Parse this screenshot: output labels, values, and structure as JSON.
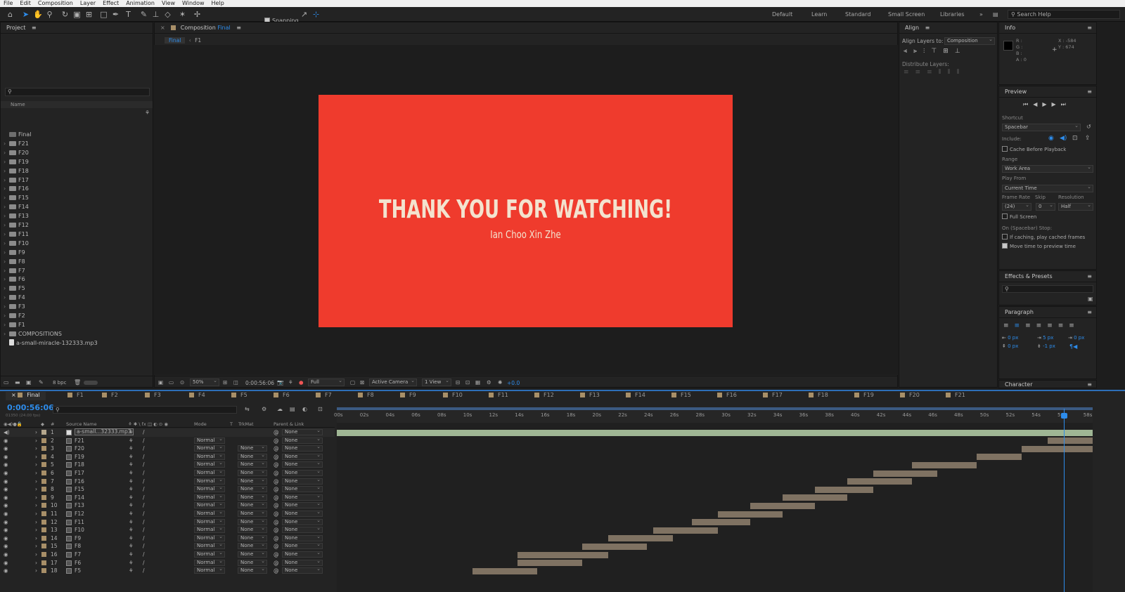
{
  "menu": [
    "File",
    "Edit",
    "Composition",
    "Layer",
    "Effect",
    "Animation",
    "View",
    "Window",
    "Help"
  ],
  "toolbar": {
    "snapping_label": "Snapping",
    "workspaces": [
      "Default",
      "Learn",
      "Standard",
      "Small Screen",
      "Libraries"
    ],
    "search_help": "Search Help"
  },
  "project": {
    "title": "Project",
    "search_placeholder": "",
    "name_header": "Name",
    "items": [
      "Final",
      "F21",
      "F20",
      "F19",
      "F18",
      "F17",
      "F16",
      "F15",
      "F14",
      "F13",
      "F12",
      "F11",
      "F10",
      "F9",
      "F8",
      "F7",
      "F6",
      "F5",
      "F4",
      "F3",
      "F2",
      "F1",
      "COMPOSITIONS",
      "a-small-miracle-132333.mp3"
    ],
    "bpc": "8 bpc"
  },
  "composition": {
    "tab_title": "Composition",
    "comp_name": "Final",
    "breadcrumb": [
      "Final",
      "F1"
    ],
    "title_text": "THANK YOU FOR WATCHING!",
    "subtitle_text": "Ian Choo Xin Zhe",
    "bg_color": "#ef3b2d",
    "text_color": "#f3e3cf",
    "zoom": "50%",
    "timecode": "0:00:56:06",
    "resolution": "Full",
    "camera": "Active Camera",
    "views": "1 View",
    "exposure": "+0.0"
  },
  "align": {
    "title": "Align",
    "align_to_label": "Align Layers to:",
    "align_to_value": "Composition",
    "distribute_label": "Distribute Layers:"
  },
  "info": {
    "title": "Info",
    "r": "R :",
    "g": "G :",
    "b": "B :",
    "a": "A : 0",
    "x": "X : -584",
    "y": "Y : 674"
  },
  "preview": {
    "title": "Preview",
    "shortcut_label": "Shortcut",
    "shortcut_value": "Spacebar",
    "include_label": "Include:",
    "cache_label": "Cache Before Playback",
    "range_label": "Range",
    "range_value": "Work Area",
    "play_from_label": "Play From",
    "play_from_value": "Current Time",
    "frame_rate_label": "Frame Rate",
    "skip_label": "Skip",
    "resolution_label": "Resolution",
    "frame_rate_value": "(24)",
    "skip_value": "0",
    "resolution_value": "Half",
    "full_screen_label": "Full Screen",
    "stop_label": "On (Spacebar) Stop:",
    "if_caching_label": "If caching, play cached frames",
    "move_time_label": "Move time to preview time"
  },
  "effects": {
    "title": "Effects & Presets"
  },
  "paragraph": {
    "title": "Paragraph",
    "v1": "0 px",
    "v2": "5 px",
    "v3": "0 px",
    "v4": "0 px",
    "v5": "-1 px"
  },
  "character": {
    "title": "Character"
  },
  "timeline": {
    "tabs": [
      "Final",
      "F1",
      "F2",
      "F3",
      "F4",
      "F5",
      "F6",
      "F7",
      "F8",
      "F9",
      "F10",
      "F11",
      "F12",
      "F13",
      "F14",
      "F15",
      "F16",
      "F17",
      "F18",
      "F19",
      "F20",
      "F21"
    ],
    "timecode": "0:00:56:06",
    "fps": "01350 (24.00 fps)",
    "headers": {
      "num": "#",
      "source": "Source Name",
      "mode": "Mode",
      "t": "T",
      "trkmat": "TrkMat",
      "parent": "Parent & Link"
    },
    "ticks": [
      "00s",
      "02s",
      "04s",
      "06s",
      "08s",
      "10s",
      "12s",
      "14s",
      "16s",
      "18s",
      "20s",
      "22s",
      "24s",
      "26s",
      "28s",
      "30s",
      "32s",
      "34s",
      "36s",
      "38s",
      "40s",
      "42s",
      "44s",
      "46s",
      "48s",
      "50s",
      "52s",
      "54s",
      "56s",
      "58s"
    ],
    "duration_s": 58.5,
    "playhead_s": 56.25,
    "layers": [
      {
        "n": "1",
        "name": "a-small...32333.mp3",
        "mode": "",
        "trk": "",
        "parent": "None",
        "start": 0,
        "end": 58.5,
        "color": "#9fb694"
      },
      {
        "n": "2",
        "name": "F21",
        "mode": "Normal",
        "trk": "",
        "parent": "None",
        "start": 55.0,
        "end": 58.5,
        "color": "#7f7262"
      },
      {
        "n": "3",
        "name": "F20",
        "mode": "Normal",
        "trk": "None",
        "parent": "None",
        "start": 53.0,
        "end": 58.5,
        "color": "#7f7262"
      },
      {
        "n": "4",
        "name": "F19",
        "mode": "Normal",
        "trk": "None",
        "parent": "None",
        "start": 49.5,
        "end": 53.0,
        "color": "#7f7262"
      },
      {
        "n": "5",
        "name": "F18",
        "mode": "Normal",
        "trk": "None",
        "parent": "None",
        "start": 44.5,
        "end": 49.5,
        "color": "#7f7262"
      },
      {
        "n": "6",
        "name": "F17",
        "mode": "Normal",
        "trk": "None",
        "parent": "None",
        "start": 41.5,
        "end": 46.5,
        "color": "#7f7262"
      },
      {
        "n": "7",
        "name": "F16",
        "mode": "Normal",
        "trk": "None",
        "parent": "None",
        "start": 39.5,
        "end": 44.5,
        "color": "#7f7262"
      },
      {
        "n": "8",
        "name": "F15",
        "mode": "Normal",
        "trk": "None",
        "parent": "None",
        "start": 37.0,
        "end": 41.5,
        "color": "#7f7262"
      },
      {
        "n": "9",
        "name": "F14",
        "mode": "Normal",
        "trk": "None",
        "parent": "None",
        "start": 34.5,
        "end": 39.5,
        "color": "#7f7262"
      },
      {
        "n": "10",
        "name": "F13",
        "mode": "Normal",
        "trk": "None",
        "parent": "None",
        "start": 32.0,
        "end": 37.0,
        "color": "#7f7262"
      },
      {
        "n": "11",
        "name": "F12",
        "mode": "Normal",
        "trk": "None",
        "parent": "None",
        "start": 29.5,
        "end": 34.5,
        "color": "#7f7262"
      },
      {
        "n": "12",
        "name": "F11",
        "mode": "Normal",
        "trk": "None",
        "parent": "None",
        "start": 27.5,
        "end": 32.0,
        "color": "#7f7262"
      },
      {
        "n": "13",
        "name": "F10",
        "mode": "Normal",
        "trk": "None",
        "parent": "None",
        "start": 24.5,
        "end": 29.5,
        "color": "#7f7262"
      },
      {
        "n": "14",
        "name": "F9",
        "mode": "Normal",
        "trk": "None",
        "parent": "None",
        "start": 21.0,
        "end": 26.0,
        "color": "#7f7262"
      },
      {
        "n": "15",
        "name": "F8",
        "mode": "Normal",
        "trk": "None",
        "parent": "None",
        "start": 19.0,
        "end": 24.0,
        "color": "#7f7262"
      },
      {
        "n": "16",
        "name": "F7",
        "mode": "Normal",
        "trk": "None",
        "parent": "None",
        "start": 14.0,
        "end": 21.0,
        "color": "#7f7262"
      },
      {
        "n": "17",
        "name": "F6",
        "mode": "Normal",
        "trk": "None",
        "parent": "None",
        "start": 14.0,
        "end": 19.0,
        "color": "#7f7262"
      },
      {
        "n": "18",
        "name": "F5",
        "mode": "Normal",
        "trk": "None",
        "parent": "None",
        "start": 10.5,
        "end": 15.5,
        "color": "#7f7262"
      }
    ]
  }
}
